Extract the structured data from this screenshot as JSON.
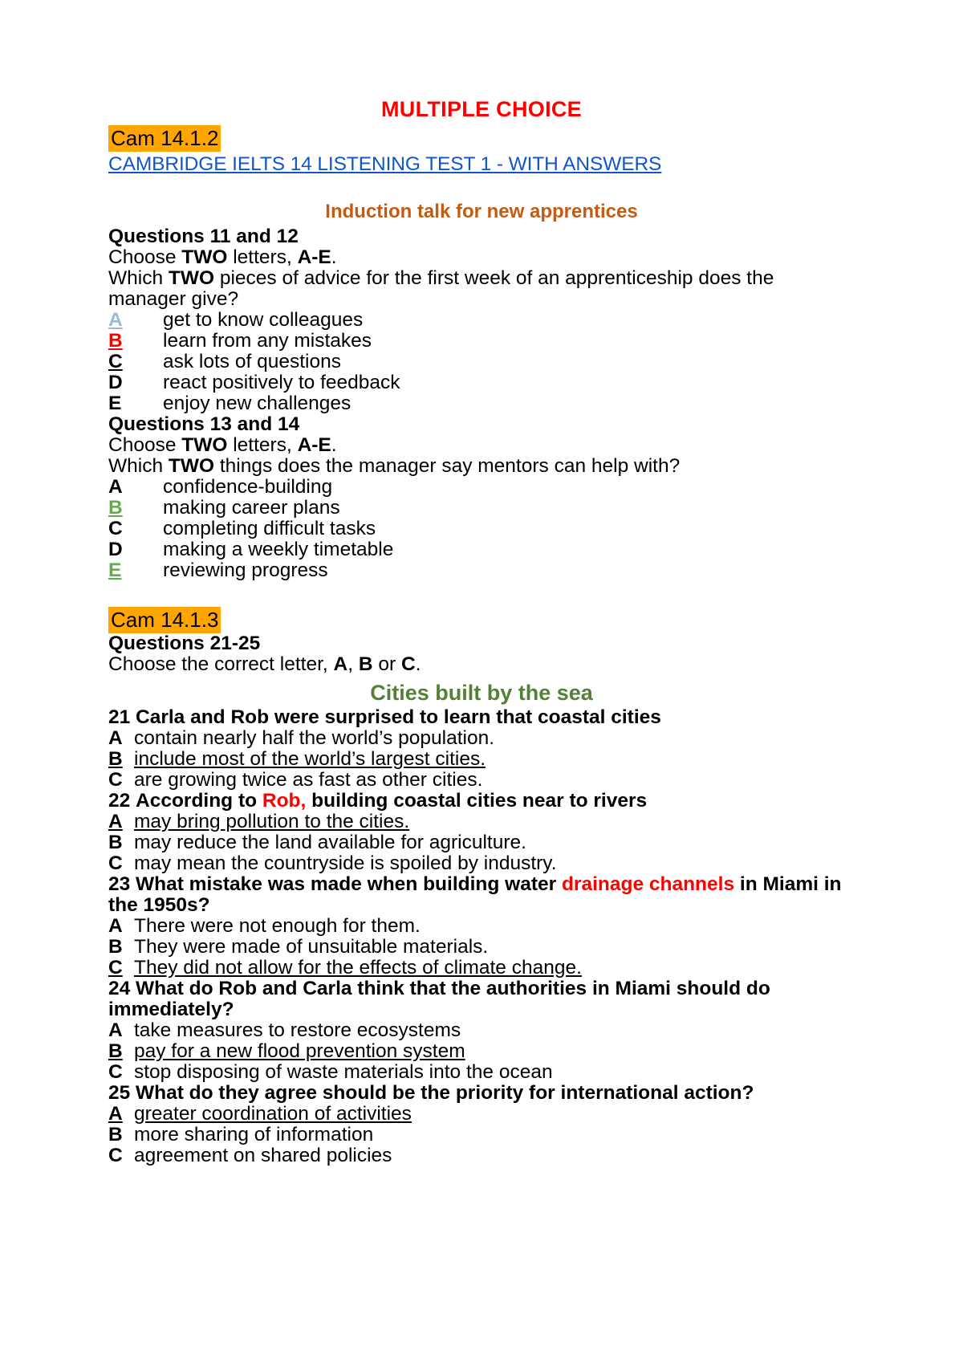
{
  "document": {
    "main_title": "MULTIPLE CHOICE",
    "colors": {
      "title_red": "#FF0000",
      "highlight_orange": "#FFA500",
      "link_blue": "#1155CC",
      "heading_orange": "#C55A11",
      "heading_green": "#538135",
      "answer_green": "#6AA84F",
      "answer_blue": "#9DB7DF"
    },
    "source_tag_1": "Cam 14.1.2",
    "source_link": "CAMBRIDGE IELTS 14 LISTENING TEST 1 - WITH ANSWERS",
    "source_tag_2": "Cam 14.1.3"
  },
  "section_one": {
    "heading": "Induction talk for new apprentices",
    "group_a": {
      "questions_label": "Questions 11 and 12",
      "instruction_pre": "Choose ",
      "instruction_two": "TWO",
      "instruction_mid": " letters, ",
      "instruction_range": "A-E",
      "instruction_end": ".",
      "prompt_pre": "Which ",
      "prompt_two": "TWO",
      "prompt_post": " pieces of advice for the first week of an apprenticeship does the manager give?",
      "options": [
        {
          "letter": "A",
          "text": "get to know colleagues"
        },
        {
          "letter": "B",
          "text": "learn from any mistakes"
        },
        {
          "letter": "C",
          "text": "ask lots of questions"
        },
        {
          "letter": "D",
          "text": "react positively to feedback"
        },
        {
          "letter": "E",
          "text": "enjoy new challenges"
        }
      ]
    },
    "group_b": {
      "questions_label": "Questions 13 and 14",
      "instruction_pre": "Choose ",
      "instruction_two": "TWO",
      "instruction_mid": " letters, ",
      "instruction_range": "A-E",
      "instruction_end": ".",
      "prompt_pre": "Which ",
      "prompt_two": "TWO",
      "prompt_post": " things does the manager say mentors can help with?",
      "options": [
        {
          "letter": "A",
          "text": "confidence-building"
        },
        {
          "letter": "B",
          "text": "making career plans"
        },
        {
          "letter": "C",
          "text": "completing difficult tasks"
        },
        {
          "letter": "D",
          "text": "making a weekly timetable"
        },
        {
          "letter": "E",
          "text": "reviewing progress"
        }
      ]
    }
  },
  "section_two": {
    "questions_label": "Questions 21-25",
    "instruction_pre": "Choose the correct letter, ",
    "instruction_a": "A",
    "instruction_comma": ", ",
    "instruction_b": "B",
    "instruction_or": " or ",
    "instruction_c": "C",
    "instruction_end": ".",
    "heading": "Cities built by the sea",
    "questions": [
      {
        "number": "21",
        "stem": "Carla and Rob were surprised to learn that coastal cities",
        "answers": [
          {
            "letter": "A",
            "text": "contain nearly half the world’s population."
          },
          {
            "letter": "B",
            "text": "include most of the world’s largest cities."
          },
          {
            "letter": "C",
            "text": "are growing twice as fast as other cities."
          }
        ]
      },
      {
        "number": "22",
        "stem_pre": "According to ",
        "stem_red": "Rob,",
        "stem_post": " building coastal cities near to rivers",
        "answers": [
          {
            "letter": "A",
            "text": "may bring pollution to the cities."
          },
          {
            "letter": "B",
            "text": "may reduce the land available for agriculture."
          },
          {
            "letter": "C",
            "text": "may mean the countryside is spoiled by industry."
          }
        ]
      },
      {
        "number": "23",
        "stem_pre": "What mistake was made when building water ",
        "stem_red": "drainage channels",
        "stem_post": " in Miami in the 1950s?",
        "answers": [
          {
            "letter": "A",
            "text": "There were not enough for them."
          },
          {
            "letter": "B",
            "text": "They were made of unsuitable materials."
          },
          {
            "letter": "C",
            "text": "They did not allow for the effects of climate change."
          }
        ]
      },
      {
        "number": "24",
        "stem": "What do Rob and Carla think that the authorities in Miami should do immediately?",
        "answers": [
          {
            "letter": "A",
            "text": "take measures to restore ecosystems"
          },
          {
            "letter": "B",
            "text": "pay for a new flood prevention system"
          },
          {
            "letter": "C",
            "text": "stop disposing of waste materials into the ocean"
          }
        ]
      },
      {
        "number": "25",
        "stem": "What do they agree should be the priority for international action?",
        "answers": [
          {
            "letter": "A",
            "text": "greater coordination of activities"
          },
          {
            "letter": "B",
            "text": "more sharing of information"
          },
          {
            "letter": "C",
            "text": "agreement on shared policies"
          }
        ]
      }
    ]
  }
}
